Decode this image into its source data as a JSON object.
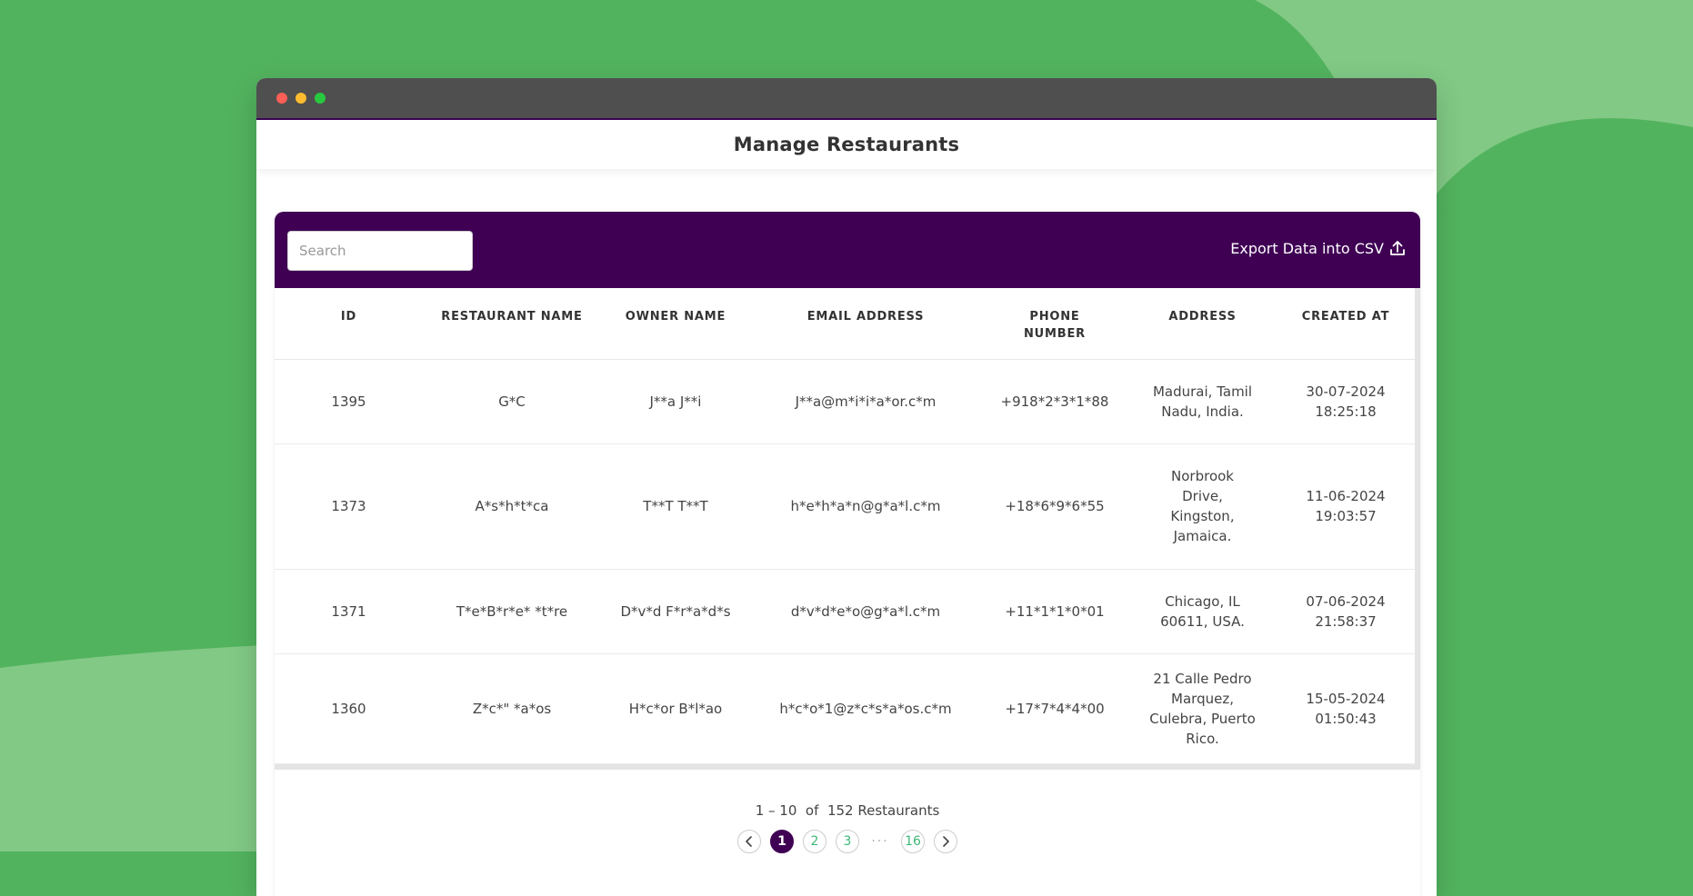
{
  "window": {
    "title": ""
  },
  "header": {
    "title": "Manage Restaurants"
  },
  "toolbar": {
    "search_placeholder": "Search",
    "search_value": "",
    "export_label": "Export Data into CSV",
    "export_icon": "upload-icon"
  },
  "table": {
    "columns": [
      "ID",
      "RESTAURANT NAME",
      "OWNER NAME",
      "EMAIL ADDRESS",
      "PHONE NUMBER",
      "ADDRESS",
      "CREATED AT"
    ],
    "rows": [
      [
        "1395",
        "G*C",
        "J**a J**i",
        "J**a@m*i*i*a*or.c*m",
        "+918*2*3*1*88",
        "Madurai, Tamil Nadu, India.",
        "30-07-2024 18:25:18"
      ],
      [
        "1373",
        "A*s*h*t*ca",
        "T**T T**T",
        "h*e*h*a*n@g*a*l.c*m",
        "+18*6*9*6*55",
        "Norbrook Drive, Kingston, Jamaica.",
        "11-06-2024 19:03:57"
      ],
      [
        "1371",
        "T*e*B*r*e* *t*re",
        "D*v*d F*r*a*d*s",
        "d*v*d*e*o@g*a*l.c*m",
        "+11*1*1*0*01",
        "Chicago, IL 60611, USA.",
        "07-06-2024 21:58:37"
      ],
      [
        "1360",
        "Z*c*\" *a*os",
        "H*c*or B*l*ao",
        "h*c*o*1@z*c*s*a*os.c*m",
        "+17*7*4*4*00",
        "21 Calle Pedro Marquez, Culebra, Puerto Rico.",
        "15-05-2024 01:50:43"
      ]
    ]
  },
  "pagination": {
    "range": "1 – 10",
    "of": "of",
    "total": "152 Restaurants",
    "pages": [
      "1",
      "2",
      "3"
    ],
    "ellipsis": "···",
    "last": "16",
    "current": "1"
  },
  "colors": {
    "background": "#52b35e",
    "accent": "#3f0054",
    "page_link": "#3cb878"
  }
}
